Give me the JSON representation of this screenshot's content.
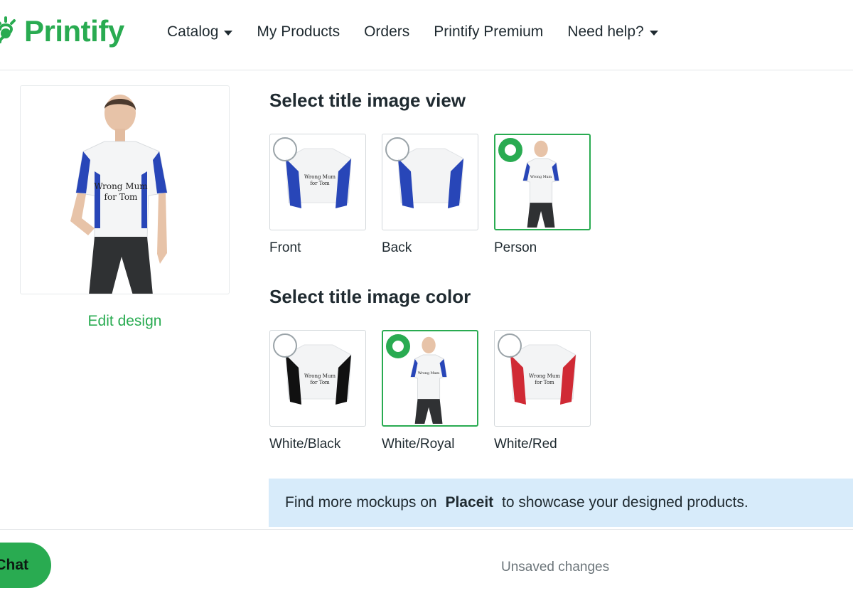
{
  "header": {
    "logo_text": "Printify",
    "nav": [
      {
        "label": "Catalog",
        "dropdown": true
      },
      {
        "label": "My Products",
        "dropdown": false
      },
      {
        "label": "Orders",
        "dropdown": false
      },
      {
        "label": "Printify Premium",
        "dropdown": false
      },
      {
        "label": "Need help?",
        "dropdown": true
      }
    ]
  },
  "preview": {
    "shirt_text_line1": "Wrong Mum",
    "shirt_text_line2": "for Tom",
    "edit_label": "Edit design"
  },
  "view_section": {
    "title": "Select title image view",
    "options": [
      {
        "label": "Front",
        "selected": false
      },
      {
        "label": "Back",
        "selected": false
      },
      {
        "label": "Person",
        "selected": true
      }
    ]
  },
  "color_section": {
    "title": "Select title image color",
    "options": [
      {
        "label": "White/Black",
        "selected": false,
        "accent": "#111111"
      },
      {
        "label": "White/Royal",
        "selected": true,
        "accent": "#2846b8"
      },
      {
        "label": "White/Red",
        "selected": false,
        "accent": "#d02a35"
      }
    ]
  },
  "banner": {
    "before": "Find more mockups on ",
    "brand": "Placeit",
    "after": " to showcase your designed products."
  },
  "footer": {
    "chat_label": "Chat",
    "status": "Unsaved changes"
  },
  "colors": {
    "brand_green": "#29ab51",
    "banner_bg": "#d7ebfa",
    "royal": "#2846b8"
  }
}
